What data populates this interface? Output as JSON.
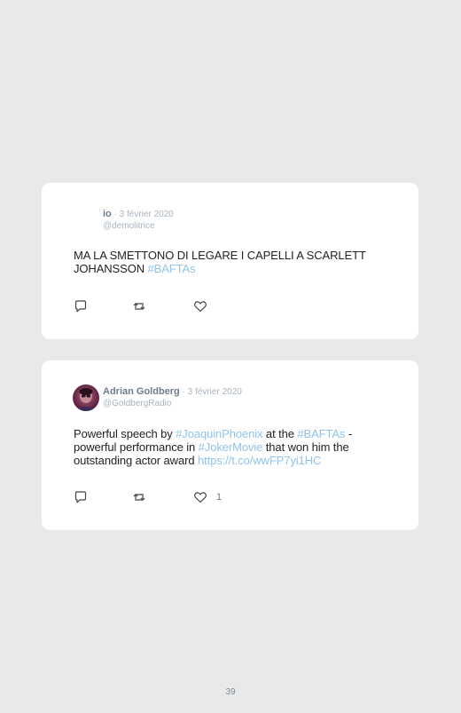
{
  "tweets": [
    {
      "name": "io",
      "separator": " · ",
      "date": "3 février 2020",
      "handle": "@demolitrice",
      "body": [
        {
          "text": "MA LA SMETTONO DI LEGARE I CAPELLI A SCARLETT JOHANSSON ",
          "link": false
        },
        {
          "text": "#BAFTAs",
          "link": true
        }
      ],
      "likes": ""
    },
    {
      "name": "Adrian Goldberg",
      "separator": " · ",
      "date": "3 février 2020",
      "handle": "@GoldbergRadio",
      "body": [
        {
          "text": "Powerful speech by ",
          "link": false
        },
        {
          "text": "#JoaquinPhoenix",
          "link": true
        },
        {
          "text": " at the ",
          "link": false
        },
        {
          "text": "#BAFTAs",
          "link": true
        },
        {
          "text": " - powerful performance in ",
          "link": false
        },
        {
          "text": "#JokerMovie",
          "link": true
        },
        {
          "text": " that won him the outstanding actor award ",
          "link": false
        },
        {
          "text": "https://t.co/wwFP7yi1HC",
          "link": true
        }
      ],
      "likes": "1"
    }
  ],
  "icons": {
    "reply": "reply-icon",
    "retweet": "retweet-icon",
    "like": "heart-icon"
  },
  "colors": {
    "background": "#e9e9e9",
    "card": "#ffffff",
    "link": "#8fc3e8",
    "name": "#6b7c8d",
    "muted": "#a9b4bf"
  },
  "page_number": "39"
}
